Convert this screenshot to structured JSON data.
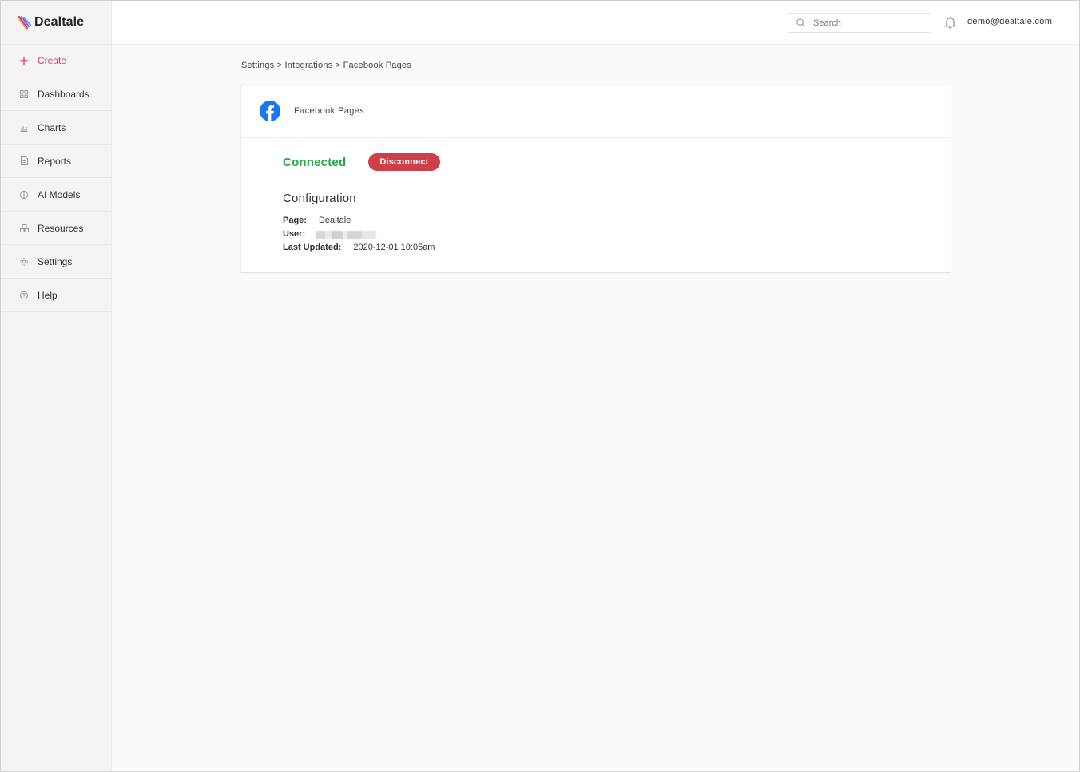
{
  "app": {
    "brand_name": "Dealtale"
  },
  "sidebar": {
    "items": [
      {
        "label": "Create",
        "icon": "plus-icon"
      },
      {
        "label": "Dashboards",
        "icon": "grid-icon"
      },
      {
        "label": "Charts",
        "icon": "bar-chart-icon"
      },
      {
        "label": "Reports",
        "icon": "document-icon"
      },
      {
        "label": "AI Models",
        "icon": "brain-icon"
      },
      {
        "label": "Resources",
        "icon": "boxes-icon"
      },
      {
        "label": "Settings",
        "icon": "gear-icon"
      },
      {
        "label": "Help",
        "icon": "question-icon"
      }
    ]
  },
  "topbar": {
    "search_placeholder": "Search",
    "user_email": "demo@dealtale.com"
  },
  "breadcrumb": {
    "items": [
      "Settings",
      "Integrations",
      "Facebook Pages"
    ],
    "separator": ">"
  },
  "integration": {
    "title": "Facebook Pages",
    "status": "Connected",
    "disconnect_label": "Disconnect",
    "config_title": "Configuration",
    "fields": [
      {
        "key": "Page:",
        "value": "Dealtale"
      },
      {
        "key": "User:",
        "value": ""
      },
      {
        "key": "Last Updated:",
        "value": "2020-12-01 10:05am"
      }
    ]
  },
  "colors": {
    "accent": "#e8336d",
    "connected": "#28a745",
    "disconnect": "#cf3f47",
    "facebook": "#1877f2"
  }
}
